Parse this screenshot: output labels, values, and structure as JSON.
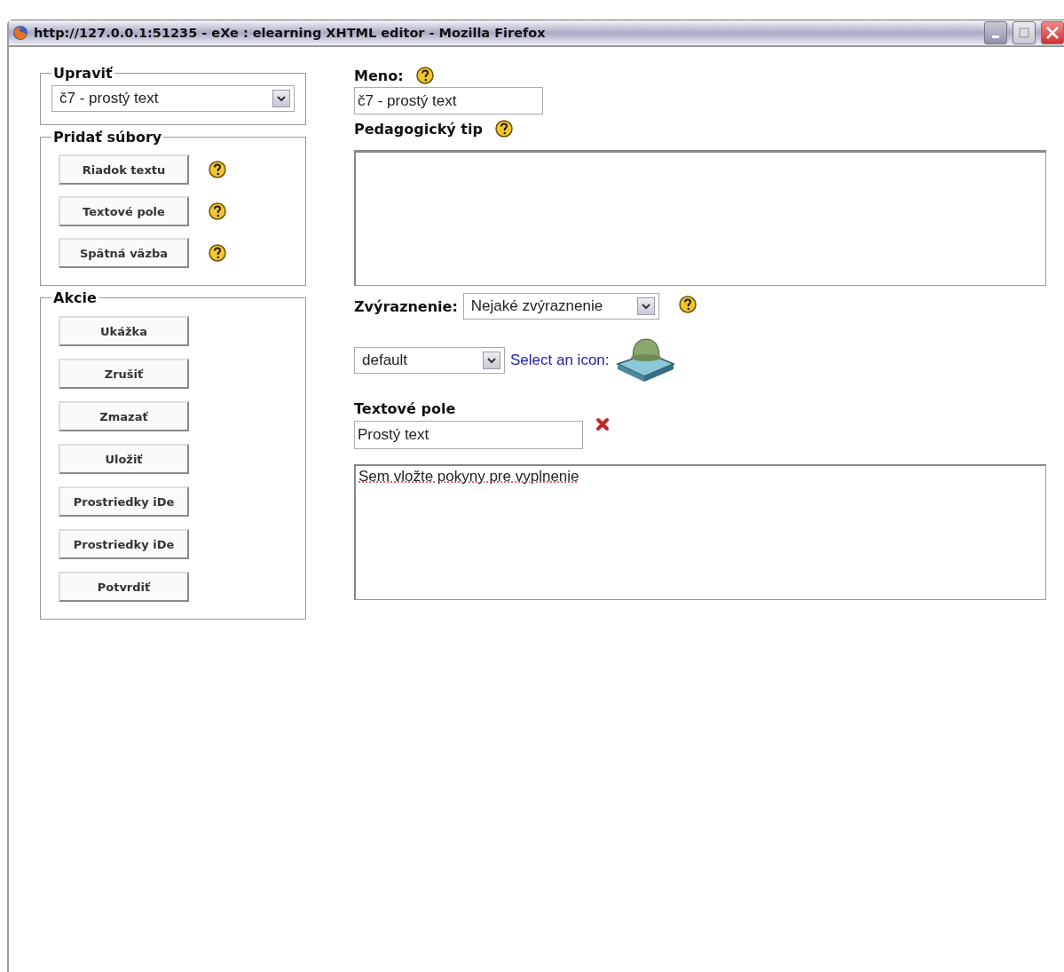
{
  "window": {
    "title": "http://127.0.0.1:51235 - eXe : elearning XHTML editor - Mozilla Firefox"
  },
  "edit_panel": {
    "legend": "Upraviť",
    "select": "č7 - prostý text"
  },
  "add_files": {
    "legend": "Pridať súbory",
    "buttons": [
      "Riadok textu",
      "Textové pole",
      "Spätná väzba"
    ]
  },
  "actions": {
    "legend": "Akcie",
    "buttons": [
      "Ukážka",
      "Zrušiť",
      "Zmazať",
      "Uložiť",
      "Prostriedky iDe",
      "Prostriedky iDe",
      "Potvrdiť"
    ]
  },
  "form": {
    "name_label": "Meno:",
    "name_value": "č7 - prostý text",
    "tip_label": "Pedagogický tip",
    "emphasis_label": "Zvýraznenie:",
    "emphasis_value": "Nejaké zvýraznenie",
    "icon_select": "default",
    "icon_link": "Select an icon:",
    "field_label": "Textové pole",
    "field_value": "Prostý text",
    "instructions": "Sem vložte pokyny pre vyplnenie"
  }
}
